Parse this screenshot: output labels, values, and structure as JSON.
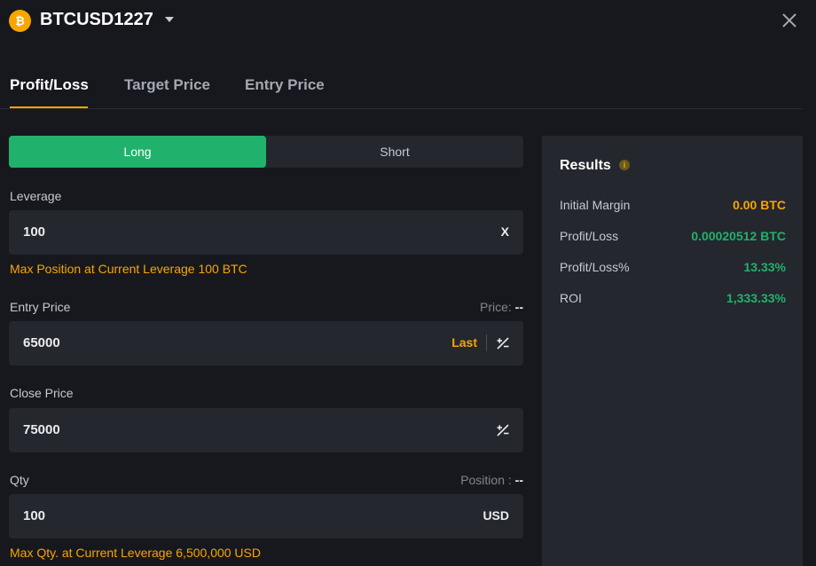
{
  "header": {
    "coin_glyph": "₿",
    "symbol": "BTCUSD1227"
  },
  "tabs": [
    {
      "label": "Profit/Loss",
      "active": true
    },
    {
      "label": "Target Price",
      "active": false
    },
    {
      "label": "Entry Price",
      "active": false
    }
  ],
  "side": {
    "long_label": "Long",
    "short_label": "Short",
    "selected": "Long"
  },
  "leverage": {
    "label": "Leverage",
    "value": "100",
    "suffix": "X",
    "hint": "Max Position at Current Leverage 100 BTC"
  },
  "entry_price": {
    "label": "Entry Price",
    "aux_label": "Price:",
    "aux_value": "--",
    "value": "65000",
    "last_label": "Last"
  },
  "close_price": {
    "label": "Close Price",
    "value": "75000"
  },
  "qty": {
    "label": "Qty",
    "aux_label": "Position :",
    "aux_value": "--",
    "value": "100",
    "suffix": "USD",
    "hint": "Max Qty. at Current Leverage 6,500,000 USD"
  },
  "results": {
    "title": "Results",
    "info_glyph": "i",
    "rows": [
      {
        "label": "Initial Margin",
        "value": "0.00 BTC",
        "color": "#f7a600"
      },
      {
        "label": "Profit/Loss",
        "value": "0.00020512 BTC",
        "color": "#20b26c"
      },
      {
        "label": "Profit/Loss%",
        "value": "13.33%",
        "color": "#20b26c"
      },
      {
        "label": "ROI",
        "value": "1,333.33%",
        "color": "#20b26c"
      }
    ]
  },
  "colors": {
    "accent": "#f7a600",
    "long_green": "#20b26c",
    "background": "#17181e",
    "panel": "#25272e"
  },
  "icons": [
    "bitcoin-icon",
    "chevron-down-icon",
    "close-icon",
    "info-icon",
    "plus-minus-icon"
  ]
}
